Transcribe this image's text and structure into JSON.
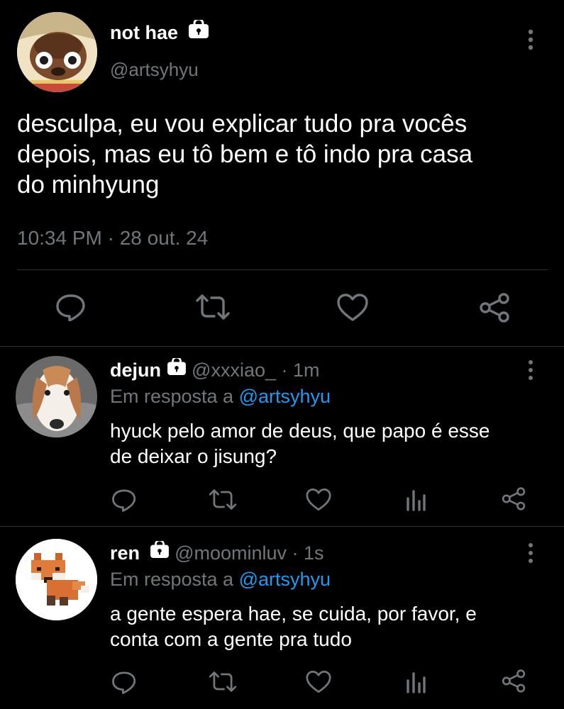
{
  "main_tweet": {
    "author_name": "not hae",
    "handle": "@artsyhyu",
    "text_line1": "desculpa, eu vou explicar tudo pra vocês",
    "text_line2": "depois, mas eu tô bem e tô indo pra casa",
    "text_line3": "do minhyung",
    "timestamp": "10:34 PM · 28 out. 24"
  },
  "replies": [
    {
      "author_name": "dejun",
      "handle": "@xxxiao_",
      "time": "· 1m",
      "reply_prefix": "Em resposta a",
      "reply_to": "@artsyhyu",
      "text_line1": "hyuck pelo amor de deus, que papo é esse",
      "text_line2": "de deixar o jisung?"
    },
    {
      "author_name": "ren",
      "handle": "@moominluv",
      "time": "· 1s",
      "reply_prefix": "Em resposta a",
      "reply_to": "@artsyhyu",
      "text_line1": "a gente espera hae, se cuida, por favor, e",
      "text_line2": "conta com a gente pra tudo"
    }
  ],
  "icons": [
    "reply-icon",
    "retweet-icon",
    "like-icon",
    "share-icon",
    "analytics-icon",
    "lock-icon",
    "more-icon"
  ],
  "colors": {
    "background": "#000000",
    "text": "#e7e9ea",
    "muted": "#71767b",
    "link": "#1d9bf0",
    "divider": "#2f3336"
  }
}
